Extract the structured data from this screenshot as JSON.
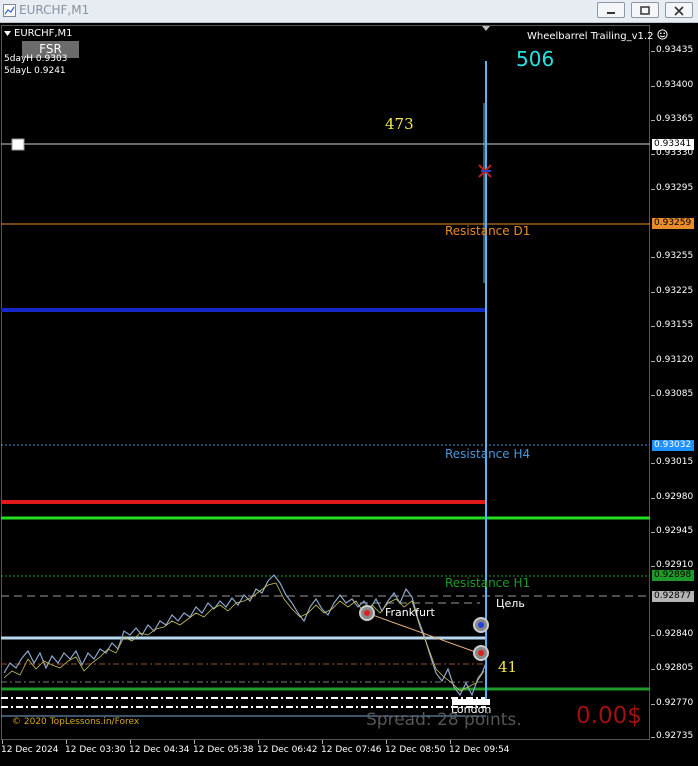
{
  "window": {
    "title": "EURCHF,M1",
    "buttons": [
      "minimize-button",
      "restore-button",
      "close-button"
    ]
  },
  "chart": {
    "symbol": "EURCHF,M1",
    "fsr_button": "FSR",
    "five_day_high": "5dayH 0.9303",
    "five_day_low": "5dayL 0.9241",
    "ea_name": "Wheelbarrel Trailing_v1.2",
    "ea_icon": "smiley-face-icon",
    "count_top": "506",
    "count_mid": "473",
    "count_bottom": "41",
    "resistance_d1": "Resistance D1",
    "resistance_h4": "Resistance H4",
    "resistance_h1": "Resistance H1",
    "target_label": "Цель",
    "frankfurt_label": "Frankfurt",
    "london_label": "London",
    "spread_label": "Spread: 28 points.",
    "profit_label": "0.00$",
    "copyright": "© 2020 TopLessons.in/Forex",
    "colors": {
      "background": "#000000",
      "resistance_d1": "#e98b2a",
      "resistance_h4": "#4a96d6",
      "resistance_h1": "#1f9a2a",
      "blue_line": "#1428c8",
      "red_line": "#e01818",
      "green_line": "#22dd22",
      "price_line": "#b8d8f0",
      "spike": "#5ab4f0",
      "profit": "#a01010",
      "counts_cyan": "#22e4e4",
      "counts_yellow": "#f4e84a"
    }
  },
  "price_axis": {
    "ticks": [
      "0.93435",
      "0.93400",
      "0.93365",
      "0.93330",
      "0.93295",
      "0.93255",
      "0.93225",
      "0.93190",
      "0.93155",
      "0.93120",
      "0.93085",
      "0.93050",
      "0.93015",
      "0.92980",
      "0.92945",
      "0.92910",
      "0.92875",
      "0.92840",
      "0.92805",
      "0.92770",
      "0.92735"
    ],
    "marked": [
      {
        "value": "0.93341",
        "role": "white-line"
      },
      {
        "value": "0.93259",
        "role": "resistance-d1"
      },
      {
        "value": "0.93032",
        "role": "resistance-h4"
      },
      {
        "value": "0.92898",
        "role": "resistance-h1"
      },
      {
        "value": "0.92877",
        "role": "target"
      }
    ]
  },
  "time_axis": {
    "labels": [
      "12 Dec 2024",
      "12 Dec 03:30",
      "12 Dec 04:34",
      "12 Dec 05:38",
      "12 Dec 06:42",
      "12 Dec 07:46",
      "12 Dec 08:50",
      "12 Dec 09:54"
    ]
  }
}
